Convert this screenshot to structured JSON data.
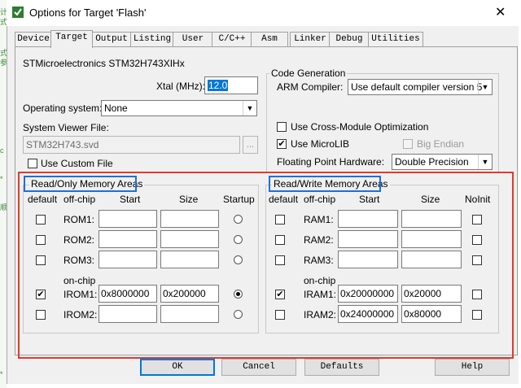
{
  "window": {
    "title": "Options for Target 'Flash'"
  },
  "tabs": [
    "Device",
    "Target",
    "Output",
    "Listing",
    "User",
    "C/C++",
    "Asm",
    "Linker",
    "Debug",
    "Utilities"
  ],
  "active_tab": "Target",
  "left_strip_glyphs": [
    "计",
    "式",
    "式",
    "参",
    "c",
    "*",
    "顺",
    "*"
  ],
  "device": {
    "name": "STMicroelectronics STM32H743XIHx"
  },
  "xtal": {
    "label": "Xtal (MHz):",
    "value": "12.0"
  },
  "os": {
    "label": "Operating system:",
    "value": "None"
  },
  "svf": {
    "label": "System Viewer File:",
    "value": "STM32H743.svd",
    "browse": "...",
    "custom_label": "Use Custom File"
  },
  "codegen": {
    "title": "Code Generation",
    "compiler_label": "ARM Compiler:",
    "compiler_value": "Use default compiler version 5",
    "cross_module": "Use Cross-Module Optimization",
    "microlib": "Use MicroLIB",
    "big_endian": "Big Endian",
    "fph_label": "Floating Point Hardware:",
    "fph_value": "Double Precision"
  },
  "ro": {
    "title": "Read/Only Memory Areas",
    "headers": {
      "default": "default",
      "offchip": "off-chip",
      "start": "Start",
      "size": "Size",
      "extra": "Startup"
    },
    "onchip_label": "on-chip",
    "rows": [
      {
        "name": "ROM1:",
        "start": "",
        "size": "",
        "checked": false,
        "selected": false
      },
      {
        "name": "ROM2:",
        "start": "",
        "size": "",
        "checked": false,
        "selected": false
      },
      {
        "name": "ROM3:",
        "start": "",
        "size": "",
        "checked": false,
        "selected": false
      },
      {
        "name": "IROM1:",
        "start": "0x8000000",
        "size": "0x200000",
        "checked": true,
        "selected": true
      },
      {
        "name": "IROM2:",
        "start": "",
        "size": "",
        "checked": false,
        "selected": false
      }
    ]
  },
  "rw": {
    "title": "Read/Write Memory Areas",
    "headers": {
      "default": "default",
      "offchip": "off-chip",
      "start": "Start",
      "size": "Size",
      "extra": "NoInit"
    },
    "onchip_label": "on-chip",
    "rows": [
      {
        "name": "RAM1:",
        "start": "",
        "size": "",
        "checked": false,
        "noinit": false
      },
      {
        "name": "RAM2:",
        "start": "",
        "size": "",
        "checked": false,
        "noinit": false
      },
      {
        "name": "RAM3:",
        "start": "",
        "size": "",
        "checked": false,
        "noinit": false
      },
      {
        "name": "IRAM1:",
        "start": "0x20000000",
        "size": "0x20000",
        "checked": true,
        "noinit": false
      },
      {
        "name": "IRAM2:",
        "start": "0x24000000",
        "size": "0x80000",
        "checked": false,
        "noinit": false
      }
    ]
  },
  "buttons": {
    "ok": "OK",
    "cancel": "Cancel",
    "defaults": "Defaults",
    "help": "Help"
  },
  "colors": {
    "highlight_box": "#1e6fd9",
    "annotation_box": "#e03a2f",
    "xtal_selection": "#0078d7"
  }
}
